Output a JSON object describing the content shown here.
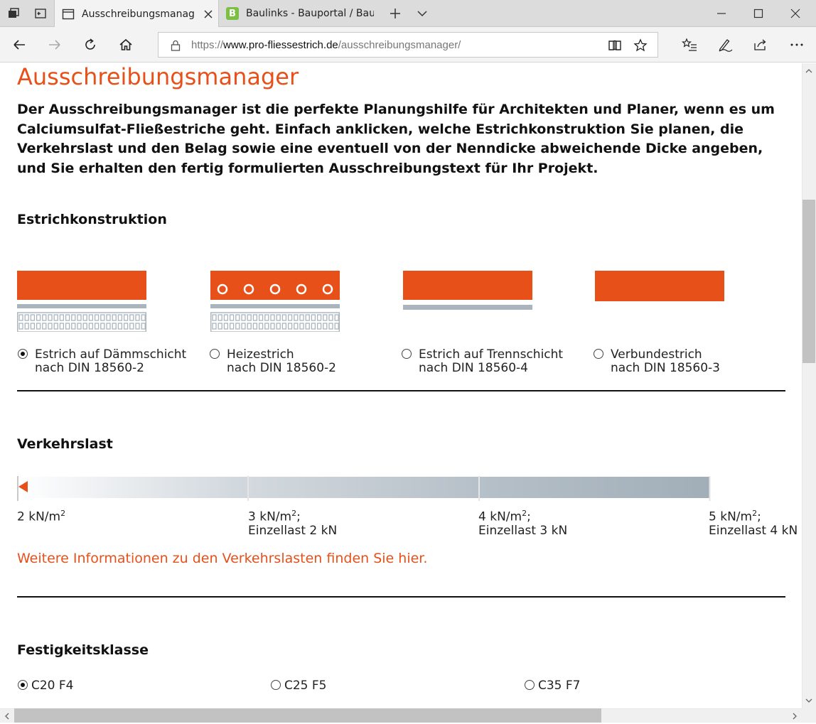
{
  "browser": {
    "tabs": [
      {
        "title": "Ausschreibungsmanage",
        "active": true
      },
      {
        "title": "Baulinks - Bauportal / Baum",
        "active": false,
        "favicon_letter": "B"
      }
    ],
    "url": {
      "scheme": "https://",
      "host": "www.pro-fliessestrich.de",
      "path": "/ausschreibungsmanager/"
    },
    "icons": [
      "tab-manager-icon",
      "tabs-aside-icon",
      "tab-icon",
      "close-tab-icon",
      "new-tab-icon",
      "tab-list-icon",
      "minimize-icon",
      "maximize-icon",
      "close-window-icon",
      "back-icon",
      "forward-icon",
      "refresh-icon",
      "home-icon",
      "lock-icon",
      "reading-view-icon",
      "favorite-star-icon",
      "favorites-list-icon",
      "pen-icon",
      "share-icon",
      "more-icon"
    ]
  },
  "page": {
    "title": "Ausschreibungsmanager",
    "intro": "Der Ausschreibungsmanager ist die perfekte Planungshilfe für Architekten und Planer, wenn es um Calciumsulfat-Fließestriche geht. Einfach anklicken, welche Estrichkonstruktion Sie planen, die Verkehrslast und den Belag sowie eine eventuell von der Nenndicke abweichende Dicke angeben, und Sie erhalten den fertig formulierten Ausschreibungstext für Ihr Projekt.",
    "construction": {
      "heading": "Estrichkonstruktion",
      "options": [
        {
          "line1": "Estrich auf Dämmschicht",
          "line2": "nach DIN 18560-2",
          "selected": true
        },
        {
          "line1": "Heizestrich",
          "line2": "nach DIN 18560-2",
          "selected": false
        },
        {
          "line1": "Estrich auf Trennschicht",
          "line2": "nach DIN 18560-4",
          "selected": false
        },
        {
          "line1": "Verbundestrich",
          "line2": "nach DIN 18560-3",
          "selected": false
        }
      ]
    },
    "load": {
      "heading": "Verkehrslast",
      "ticks": [
        {
          "line1": "2 kN/m",
          "sup": "2",
          "suffix": "",
          "line2": ""
        },
        {
          "line1": "3 kN/m",
          "sup": "2",
          "suffix": ";",
          "line2": "Einzellast 2 kN"
        },
        {
          "line1": "4 kN/m",
          "sup": "2",
          "suffix": ";",
          "line2": "Einzellast 3 kN"
        },
        {
          "line1": "5 kN/m",
          "sup": "2",
          "suffix": ";",
          "line2": "Einzellast 4 kN"
        }
      ],
      "selected_index": 0,
      "link": "Weitere Informationen zu den Verkehrslasten finden Sie hier."
    },
    "strength": {
      "heading": "Festigkeitsklasse",
      "options": [
        {
          "label": "C20 F4",
          "selected": true
        },
        {
          "label": "C25 F5",
          "selected": false
        },
        {
          "label": "C35 F7",
          "selected": false
        }
      ]
    }
  },
  "colors": {
    "accent": "#e8501a",
    "layer_grey": "#a9b4bc",
    "slider_dark": "#a3b0ba"
  }
}
